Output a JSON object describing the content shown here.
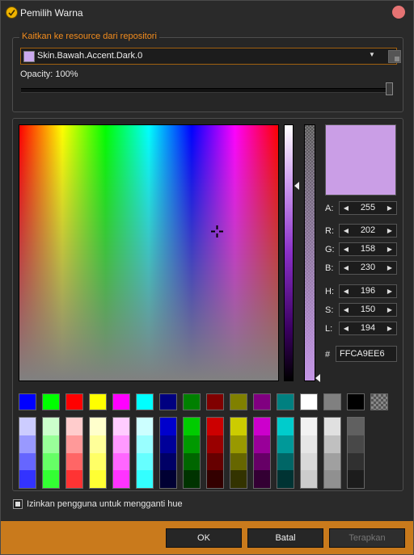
{
  "window": {
    "title": "Pemilih Warna"
  },
  "resource": {
    "legend": "Kaitkan ke resource dari repositori",
    "selected": "Skin.Bawah.Accent.Dark.0",
    "swatch_color": "#caa9ee",
    "opacity_label": "Opacity: 100%",
    "opacity_value": 1.0
  },
  "color": {
    "preview_color": "#ca9ee6",
    "channels": [
      {
        "label": "A:",
        "value": "255"
      },
      {
        "label": "R:",
        "value": "202"
      },
      {
        "label": "G:",
        "value": "158"
      },
      {
        "label": "B:",
        "value": "230"
      },
      {
        "label": "H:",
        "value": "196"
      },
      {
        "label": "S:",
        "value": "150"
      },
      {
        "label": "L:",
        "value": "194"
      }
    ],
    "hex_label": "#",
    "hex_value": "FFCA9EE6"
  },
  "palette": {
    "base": [
      "#0000ff",
      "#00ff00",
      "#ff0000",
      "#ffff00",
      "#ff00ff",
      "#00ffff",
      "#000080",
      "#008000",
      "#800000",
      "#808000",
      "#800080",
      "#008080",
      "#ffffff",
      "#808080",
      "#000000",
      "transparent"
    ],
    "shades": [
      [
        "#ccccff",
        "#9999ff",
        "#6666ff",
        "#3333ff"
      ],
      [
        "#ccffcc",
        "#99ff99",
        "#66ff66",
        "#33ff33"
      ],
      [
        "#ffcccc",
        "#ff9999",
        "#ff6666",
        "#ff3333"
      ],
      [
        "#ffffcc",
        "#ffff99",
        "#ffff66",
        "#ffff33"
      ],
      [
        "#ffccff",
        "#ff99ff",
        "#ff66ff",
        "#ff33ff"
      ],
      [
        "#ccffff",
        "#99ffff",
        "#66ffff",
        "#33ffff"
      ],
      [
        "#0000cc",
        "#000099",
        "#000066",
        "#000033"
      ],
      [
        "#00cc00",
        "#009900",
        "#006600",
        "#003300"
      ],
      [
        "#cc0000",
        "#990000",
        "#660000",
        "#330000"
      ],
      [
        "#cccc00",
        "#999900",
        "#666600",
        "#333300"
      ],
      [
        "#cc00cc",
        "#990099",
        "#660066",
        "#330033"
      ],
      [
        "#00cccc",
        "#009999",
        "#006666",
        "#003333"
      ],
      [
        "#f2f2f2",
        "#e6e6e6",
        "#d9d9d9",
        "#cccccc"
      ],
      [
        "#e0e0e0",
        "#c0c0c0",
        "#a0a0a0",
        "#909090"
      ],
      [
        "#606060",
        "#484848",
        "#303030",
        "#1c1c1c"
      ]
    ]
  },
  "options": {
    "allow_hue_label": "Izinkan pengguna untuk mengganti hue",
    "allow_hue_checked": true
  },
  "buttons": {
    "ok": "OK",
    "cancel": "Batal",
    "apply": "Terapkan"
  }
}
